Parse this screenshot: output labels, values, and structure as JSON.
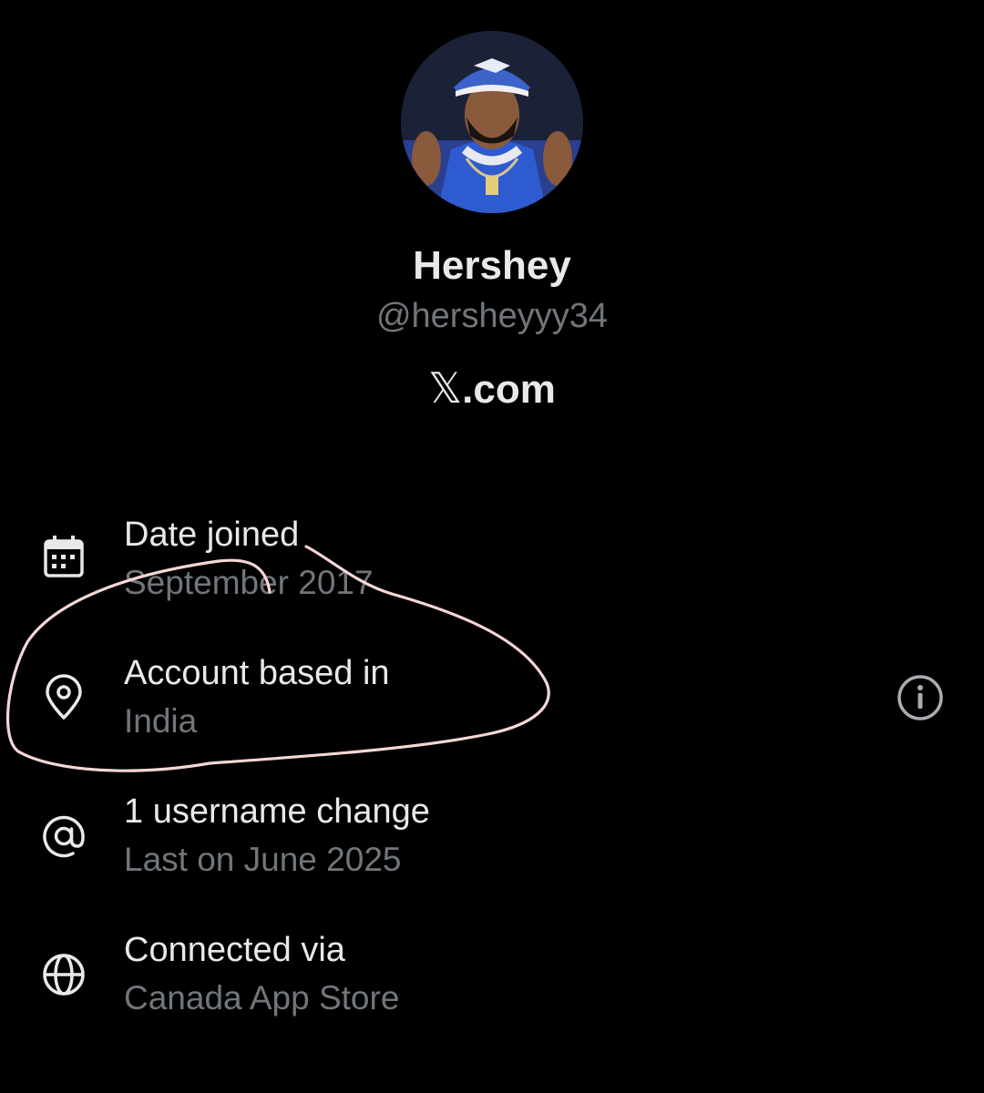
{
  "profile": {
    "display_name": "Hershey",
    "handle": "@hersheyyy34",
    "site_prefix": "𝕏",
    "site_suffix": ".com",
    "avatar_icon": "profile-photo"
  },
  "about_rows": [
    {
      "icon": "calendar-icon",
      "title": "Date joined",
      "value": "September 2017"
    },
    {
      "icon": "location-pin-icon",
      "title": "Account based in",
      "value": "India",
      "action_icon": "info-icon"
    },
    {
      "icon": "at-sign-icon",
      "title": "1 username change",
      "value": "Last on June 2025"
    },
    {
      "icon": "globe-icon",
      "title": "Connected via",
      "value": "Canada App Store"
    }
  ],
  "colors": {
    "background": "#000000",
    "primary_text": "#e7e9ea",
    "secondary_text": "#71767b",
    "annotation_stroke": "#f6d6d6"
  }
}
